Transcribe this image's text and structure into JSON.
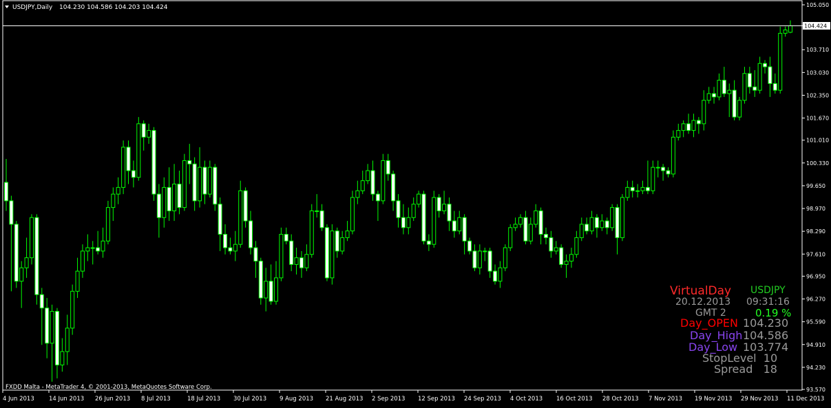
{
  "header": {
    "symbol_label": "USDJPY,Daily",
    "ohlc": "104.230 104.586 104.203 104.424"
  },
  "footer_text": "FXDD Malta - MetaTrader 4, © 2001-2013, MetaQuotes Software Corp.",
  "current_price_label": "104.424",
  "colors": {
    "background": "#000000",
    "grid_frame": "#ffffff",
    "bull_body": "#000000",
    "bear_body": "#ffffff",
    "wick": "#00ff00",
    "price_line": "#ffffff",
    "virtual_day": "#ff2a2a",
    "symbol_tag": "#22cc22",
    "gray_text": "#9a9a9a",
    "change_pct": "#22ff22",
    "day_open": "#ff0000",
    "day_high_low": "#8844ee"
  },
  "info_panel": {
    "title": "VirtualDay",
    "symbol": "USDJPY",
    "date": "20.12.2013",
    "time": "09:31:16",
    "gmt": "GMT 2",
    "change": "0.19 %",
    "open_label": "Day_OPEN",
    "open_value": "104.230",
    "high_label": "Day_High",
    "high_value": "104.586",
    "low_label": "Day_Low",
    "low_value": "103.774",
    "stoplevel": "StopLevel  10",
    "spread": "Spread   18"
  },
  "chart_data": {
    "type": "candlestick",
    "symbol": "USDJPY",
    "timeframe": "Daily",
    "ylim": [
      93.57,
      105.05
    ],
    "y_ticks": [
      "105.050",
      "104.424",
      "103.710",
      "103.030",
      "102.350",
      "101.670",
      "101.010",
      "100.330",
      "99.650",
      "98.970",
      "98.290",
      "97.610",
      "96.950",
      "96.270",
      "95.590",
      "94.910",
      "94.230",
      "93.570"
    ],
    "x_ticks": [
      "4 Jun 2013",
      "14 Jun 2013",
      "26 Jun 2013",
      "8 Jul 2013",
      "18 Jul 2013",
      "30 Jul 2013",
      "9 Aug 2013",
      "21 Aug 2013",
      "2 Sep 2013",
      "12 Sep 2013",
      "24 Sep 2013",
      "4 Oct 2013",
      "16 Oct 2013",
      "28 Oct 2013",
      "7 Nov 2013",
      "19 Nov 2013",
      "29 Nov 2013",
      "11 Dec 2013"
    ],
    "candles": [
      [
        99.75,
        99.2,
        100.45,
        98.9
      ],
      [
        99.2,
        98.5,
        99.35,
        96.5
      ],
      [
        98.5,
        96.8,
        98.6,
        96.6
      ],
      [
        96.8,
        97.2,
        97.4,
        96.0
      ],
      [
        97.2,
        97.5,
        98.1,
        96.9
      ],
      [
        97.5,
        98.7,
        98.8,
        97.3
      ],
      [
        98.7,
        96.4,
        98.8,
        96.1
      ],
      [
        96.4,
        96.0,
        96.6,
        94.9
      ],
      [
        96.0,
        94.95,
        96.3,
        94.5
      ],
      [
        94.95,
        95.9,
        96.1,
        93.8
      ],
      [
        95.9,
        94.3,
        96.0,
        93.9
      ],
      [
        94.3,
        94.7,
        95.1,
        94.1
      ],
      [
        94.7,
        95.4,
        95.8,
        94.3
      ],
      [
        95.4,
        96.5,
        96.7,
        95.2
      ],
      [
        96.5,
        97.1,
        97.5,
        96.3
      ],
      [
        97.1,
        97.7,
        97.9,
        96.9
      ],
      [
        97.7,
        97.8,
        98.2,
        97.4
      ],
      [
        97.8,
        97.8,
        98.0,
        97.3
      ],
      [
        97.8,
        97.7,
        98.3,
        97.6
      ],
      [
        97.7,
        98.0,
        98.4,
        97.5
      ],
      [
        98.0,
        99.0,
        99.2,
        97.9
      ],
      [
        99.0,
        99.4,
        99.6,
        98.6
      ],
      [
        99.4,
        99.6,
        99.9,
        99.1
      ],
      [
        99.6,
        100.8,
        101.0,
        99.4
      ],
      [
        100.8,
        100.1,
        101.0,
        99.7
      ],
      [
        100.1,
        99.9,
        100.4,
        99.6
      ],
      [
        99.9,
        101.5,
        101.7,
        99.8
      ],
      [
        101.5,
        101.1,
        101.6,
        100.7
      ],
      [
        101.1,
        101.3,
        101.5,
        100.9
      ],
      [
        101.3,
        99.4,
        101.4,
        99.2
      ],
      [
        99.4,
        98.7,
        99.7,
        98.1
      ],
      [
        98.7,
        99.6,
        99.9,
        98.4
      ],
      [
        99.6,
        98.9,
        100.2,
        98.6
      ],
      [
        98.9,
        99.7,
        100.3,
        98.6
      ],
      [
        99.7,
        99.0,
        100.1,
        98.8
      ],
      [
        99.0,
        100.4,
        100.6,
        98.9
      ],
      [
        100.4,
        100.3,
        100.9,
        99.7
      ],
      [
        100.3,
        99.2,
        100.5,
        98.9
      ],
      [
        99.2,
        100.2,
        100.8,
        99.0
      ],
      [
        100.2,
        99.4,
        100.4,
        99.1
      ],
      [
        99.4,
        100.2,
        100.4,
        99.3
      ],
      [
        100.2,
        99.1,
        100.3,
        98.9
      ],
      [
        99.1,
        98.2,
        99.3,
        97.7
      ],
      [
        98.2,
        97.8,
        98.5,
        97.6
      ],
      [
        97.8,
        97.7,
        98.1,
        97.6
      ],
      [
        97.7,
        97.9,
        98.3,
        97.4
      ],
      [
        97.9,
        99.5,
        99.8,
        97.8
      ],
      [
        99.5,
        98.6,
        99.6,
        98.4
      ],
      [
        98.6,
        97.8,
        98.9,
        97.6
      ],
      [
        97.8,
        97.4,
        98.0,
        96.9
      ],
      [
        97.4,
        96.3,
        97.5,
        96.1
      ],
      [
        96.3,
        96.8,
        97.2,
        95.9
      ],
      [
        96.8,
        96.2,
        97.3,
        96.1
      ],
      [
        96.2,
        96.9,
        97.4,
        96.1
      ],
      [
        96.9,
        98.2,
        98.4,
        96.8
      ],
      [
        98.2,
        98.0,
        98.4,
        97.9
      ],
      [
        98.0,
        97.3,
        98.2,
        97.1
      ],
      [
        97.3,
        97.5,
        97.8,
        97.0
      ],
      [
        97.5,
        97.2,
        97.7,
        96.9
      ],
      [
        97.2,
        97.6,
        97.9,
        97.1
      ],
      [
        97.6,
        98.9,
        99.1,
        97.5
      ],
      [
        98.9,
        98.9,
        99.4,
        98.7
      ],
      [
        98.9,
        98.4,
        99.1,
        98.3
      ],
      [
        98.4,
        96.9,
        98.5,
        96.8
      ],
      [
        96.9,
        98.3,
        98.5,
        96.7
      ],
      [
        98.3,
        97.7,
        98.4,
        97.5
      ],
      [
        97.7,
        98.1,
        98.3,
        97.6
      ],
      [
        98.1,
        98.3,
        98.6,
        98.0
      ],
      [
        98.3,
        99.3,
        99.5,
        98.2
      ],
      [
        99.3,
        99.5,
        99.8,
        99.1
      ],
      [
        99.5,
        99.8,
        100.1,
        99.4
      ],
      [
        99.8,
        100.1,
        100.3,
        99.7
      ],
      [
        100.1,
        99.4,
        100.4,
        99.2
      ],
      [
        99.4,
        99.2,
        99.5,
        98.6
      ],
      [
        99.2,
        100.4,
        100.6,
        99.1
      ],
      [
        100.4,
        100.0,
        100.6,
        99.8
      ],
      [
        100.0,
        99.2,
        100.1,
        98.9
      ],
      [
        99.2,
        98.7,
        99.4,
        98.4
      ],
      [
        98.7,
        98.4,
        99.1,
        98.2
      ],
      [
        98.4,
        98.7,
        99.0,
        98.2
      ],
      [
        98.7,
        99.1,
        99.3,
        98.6
      ],
      [
        99.1,
        99.4,
        99.5,
        99.0
      ],
      [
        99.4,
        98.0,
        99.5,
        97.9
      ],
      [
        98.0,
        97.9,
        98.2,
        97.7
      ],
      [
        97.9,
        99.3,
        99.5,
        97.8
      ],
      [
        99.3,
        98.9,
        99.4,
        98.7
      ],
      [
        98.9,
        99.1,
        99.5,
        98.8
      ],
      [
        99.1,
        98.6,
        99.3,
        98.3
      ],
      [
        98.6,
        98.3,
        98.9,
        98.1
      ],
      [
        98.3,
        98.7,
        98.9,
        98.2
      ],
      [
        98.7,
        98.0,
        98.8,
        97.6
      ],
      [
        98.0,
        97.7,
        98.1,
        97.6
      ],
      [
        97.7,
        97.2,
        97.9,
        97.1
      ],
      [
        97.2,
        97.7,
        97.9,
        97.0
      ],
      [
        97.7,
        97.7,
        97.8,
        97.4
      ],
      [
        97.7,
        97.1,
        97.8,
        96.9
      ],
      [
        97.1,
        96.8,
        97.3,
        96.7
      ],
      [
        96.8,
        97.2,
        97.4,
        96.6
      ],
      [
        97.2,
        97.8,
        97.9,
        97.1
      ],
      [
        97.8,
        98.4,
        98.5,
        97.7
      ],
      [
        98.4,
        98.5,
        98.7,
        98.3
      ],
      [
        98.5,
        98.7,
        98.8,
        98.4
      ],
      [
        98.7,
        98.0,
        98.9,
        97.9
      ],
      [
        98.0,
        98.5,
        98.7,
        97.9
      ],
      [
        98.5,
        98.9,
        99.1,
        98.4
      ],
      [
        98.9,
        98.2,
        99.0,
        97.9
      ],
      [
        98.2,
        98.1,
        98.4,
        97.9
      ],
      [
        98.1,
        97.7,
        98.3,
        97.5
      ],
      [
        97.7,
        97.8,
        98.0,
        97.6
      ],
      [
        97.8,
        97.3,
        97.9,
        97.2
      ],
      [
        97.3,
        97.4,
        97.6,
        96.9
      ],
      [
        97.4,
        97.6,
        97.8,
        97.2
      ],
      [
        97.6,
        98.1,
        98.3,
        97.5
      ],
      [
        98.1,
        98.5,
        98.7,
        98.0
      ],
      [
        98.5,
        98.3,
        98.7,
        98.2
      ],
      [
        98.3,
        98.7,
        98.9,
        98.2
      ],
      [
        98.7,
        98.4,
        98.8,
        98.1
      ],
      [
        98.4,
        98.6,
        98.8,
        98.3
      ],
      [
        98.6,
        98.4,
        98.7,
        98.2
      ],
      [
        98.4,
        99.0,
        99.1,
        98.3
      ],
      [
        99.0,
        98.1,
        99.1,
        97.6
      ],
      [
        98.1,
        99.3,
        99.4,
        98.0
      ],
      [
        99.3,
        99.6,
        99.8,
        99.2
      ],
      [
        99.6,
        99.5,
        99.8,
        99.3
      ],
      [
        99.5,
        99.5,
        99.7,
        99.3
      ],
      [
        99.5,
        99.6,
        99.8,
        99.4
      ],
      [
        99.6,
        99.5,
        100.4,
        99.4
      ],
      [
        99.5,
        100.2,
        100.4,
        99.4
      ],
      [
        100.2,
        100.2,
        100.4,
        99.9
      ],
      [
        100.2,
        100.1,
        100.3,
        99.8
      ],
      [
        100.1,
        100.0,
        100.2,
        99.9
      ],
      [
        100.0,
        101.1,
        101.3,
        99.9
      ],
      [
        101.1,
        101.3,
        101.5,
        101.0
      ],
      [
        101.3,
        101.5,
        101.6,
        101.1
      ],
      [
        101.5,
        101.3,
        101.8,
        101.2
      ],
      [
        101.3,
        101.6,
        101.8,
        101.1
      ],
      [
        101.6,
        101.5,
        101.7,
        101.2
      ],
      [
        101.5,
        102.2,
        102.5,
        101.3
      ],
      [
        102.2,
        102.4,
        102.6,
        102.1
      ],
      [
        102.4,
        102.3,
        102.6,
        102.1
      ],
      [
        102.3,
        102.8,
        103.0,
        102.2
      ],
      [
        102.8,
        102.4,
        103.2,
        102.3
      ],
      [
        102.4,
        102.5,
        102.7,
        101.7
      ],
      [
        102.5,
        101.7,
        102.8,
        101.6
      ],
      [
        101.7,
        102.2,
        102.3,
        101.6
      ],
      [
        102.2,
        103.0,
        103.2,
        102.1
      ],
      [
        103.0,
        102.6,
        103.2,
        102.4
      ],
      [
        102.6,
        102.5,
        103.1,
        102.3
      ],
      [
        102.5,
        103.3,
        103.5,
        102.4
      ],
      [
        103.3,
        103.2,
        103.4,
        103.0
      ],
      [
        103.2,
        102.7,
        103.5,
        102.3
      ],
      [
        102.7,
        102.5,
        103.0,
        102.4
      ],
      [
        102.5,
        104.2,
        104.4,
        102.4
      ],
      [
        104.2,
        104.3,
        104.4,
        104.1
      ],
      [
        104.23,
        104.424,
        104.586,
        104.203
      ]
    ]
  }
}
